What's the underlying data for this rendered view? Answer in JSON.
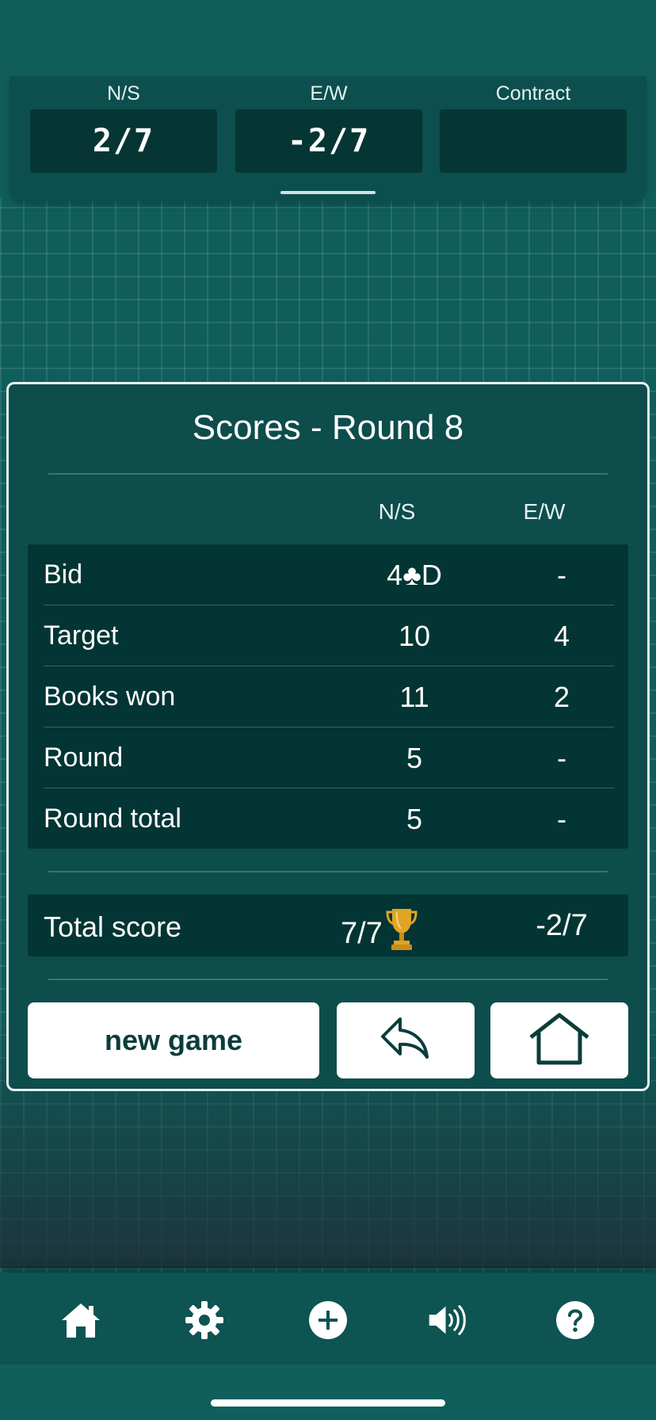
{
  "top_bar": {
    "ns_label": "N/S",
    "ns_value": "2/7",
    "ew_label": "E/W",
    "ew_value": "-2/7",
    "contract_label": "Contract",
    "contract_value": ""
  },
  "modal": {
    "title": "Scores - Round 8",
    "col_ns": "N/S",
    "col_ew": "E/W",
    "rows": [
      {
        "label": "Bid",
        "ns": "4♣D",
        "ew": "-"
      },
      {
        "label": "Target",
        "ns": "10",
        "ew": "4"
      },
      {
        "label": "Books won",
        "ns": "11",
        "ew": "2"
      },
      {
        "label": "Round",
        "ns": "5",
        "ew": "-"
      },
      {
        "label": "Round total",
        "ns": "5",
        "ew": "-"
      }
    ],
    "total": {
      "label": "Total score",
      "ns": "7/7",
      "ew": "-2/7"
    },
    "new_game_label": "new game"
  },
  "icons": {
    "winner": "trophy-icon",
    "back": "undo-arrow-icon",
    "home": "home-outline-icon",
    "nav": [
      "home-icon",
      "gear-icon",
      "plus-circle-icon",
      "speaker-icon",
      "help-icon"
    ]
  },
  "colors": {
    "background": "#0f5e5c",
    "panel": "#0d4d4b",
    "table": "#023533",
    "trophy": "#e0a525"
  }
}
